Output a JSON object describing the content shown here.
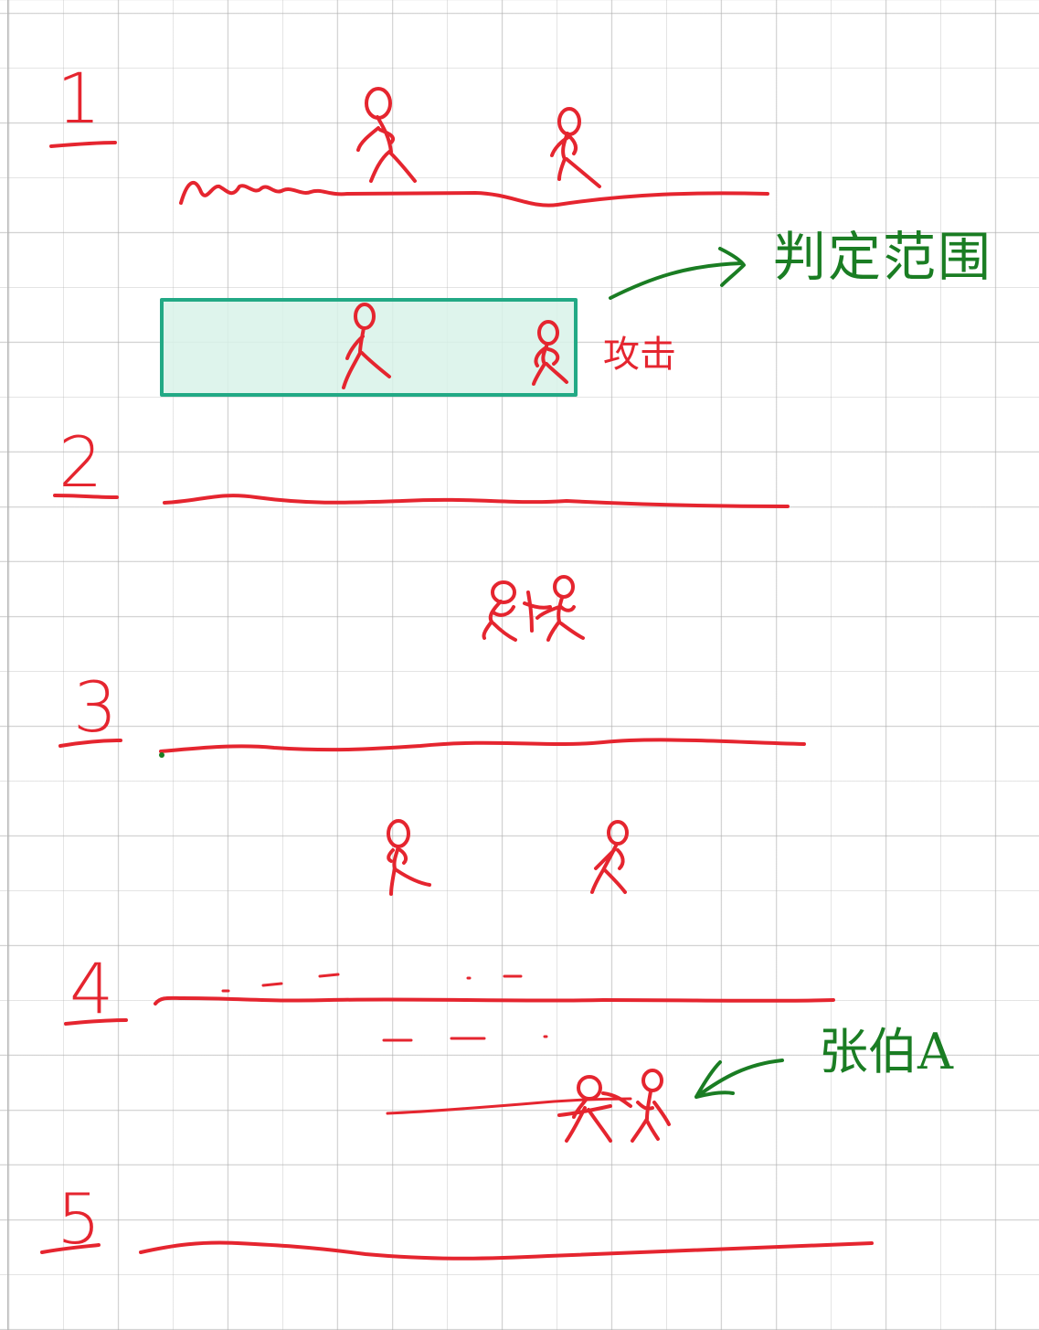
{
  "colors": {
    "ink_red": "#e5252f",
    "ink_green": "#1a7d23",
    "box_border": "#22a985",
    "box_fill": "#d8f2e9"
  },
  "scenes": [
    {
      "number": "1"
    },
    {
      "number": "2"
    },
    {
      "number": "3"
    },
    {
      "number": "4"
    },
    {
      "number": "5"
    }
  ],
  "annotations": {
    "judgement_range": "判定范围",
    "attack": "攻击",
    "player_a": "张伯A"
  }
}
